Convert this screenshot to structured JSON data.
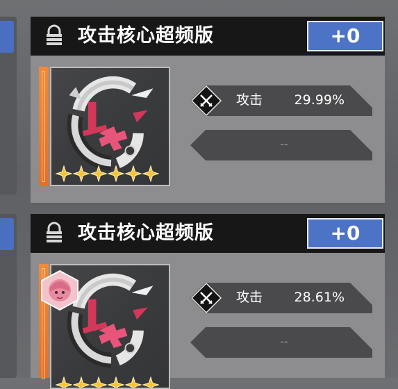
{
  "cards": [
    {
      "title": "攻击核心超频版",
      "level_label": "+0",
      "stars": 6,
      "stat_main": {
        "name": "攻击",
        "value": "29.99%"
      },
      "stat_second": {
        "value": "--"
      },
      "equipped_avatar": false
    },
    {
      "title": "攻击核心超频版",
      "level_label": "+0",
      "stars": 6,
      "stat_main": {
        "name": "攻击",
        "value": "28.61%"
      },
      "stat_second": {
        "value": "--"
      },
      "equipped_avatar": true
    }
  ],
  "icons": [
    "lock-icon",
    "attack-core-icon",
    "star-icon",
    "crossed-swords-icon",
    "character-avatar-icon"
  ],
  "colors": {
    "accent_blue": "#4d73c6",
    "rarity_orange": "#f08a3a",
    "core_pink": "#d2385a",
    "star_gold": "#f6c23a"
  }
}
